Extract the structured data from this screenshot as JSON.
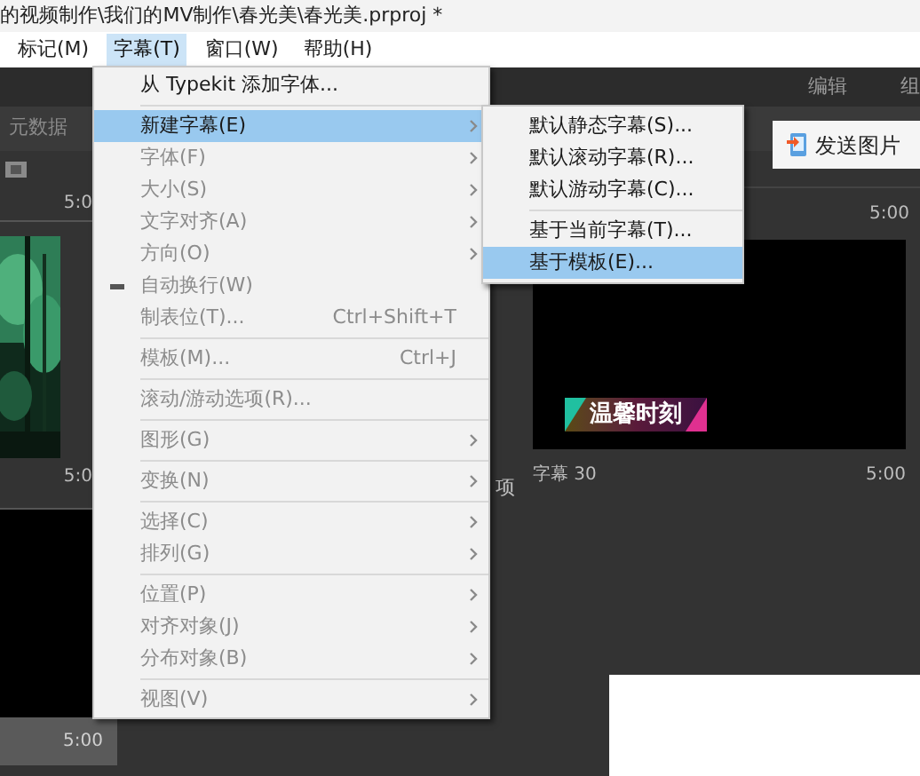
{
  "title_bar": {
    "path": "的视频制作\\我们的MV制作\\春光美\\春光美.prproj *"
  },
  "menu_bar": [
    {
      "label": "标记(M)",
      "selected": false
    },
    {
      "label": "字幕(T)",
      "selected": true
    },
    {
      "label": "窗口(W)",
      "selected": false
    },
    {
      "label": "帮助(H)",
      "selected": false
    }
  ],
  "workspace_tabs": [
    "编辑",
    "组"
  ],
  "panel_tab": "元数据",
  "left_clips": [
    {
      "kind": "forest",
      "top_time": "5:0",
      "time": "5:0"
    },
    {
      "kind": "black",
      "time": "5:00"
    }
  ],
  "cut_label": "项",
  "title_clip": {
    "top_time": "5:00",
    "caption": "温馨时刻",
    "name": "字幕 30",
    "time": "5:00"
  },
  "title_menu": {
    "items": [
      {
        "kind": "item",
        "label": "从 Typekit 添加字体...",
        "disabled": false,
        "selected": false,
        "checked": false,
        "submenu": false
      },
      {
        "kind": "separator"
      },
      {
        "kind": "item",
        "label": "新建字幕(E)",
        "disabled": false,
        "selected": true,
        "checked": false,
        "submenu": true
      },
      {
        "kind": "item",
        "label": "字体(F)",
        "disabled": true,
        "selected": false,
        "checked": false,
        "submenu": true
      },
      {
        "kind": "item",
        "label": "大小(S)",
        "disabled": true,
        "selected": false,
        "checked": false,
        "submenu": true
      },
      {
        "kind": "item",
        "label": "文字对齐(A)",
        "disabled": true,
        "selected": false,
        "checked": false,
        "submenu": true
      },
      {
        "kind": "item",
        "label": "方向(O)",
        "disabled": true,
        "selected": false,
        "checked": false,
        "submenu": true
      },
      {
        "kind": "item",
        "label": "自动换行(W)",
        "disabled": true,
        "selected": false,
        "checked": true,
        "submenu": false
      },
      {
        "kind": "item",
        "label": "制表位(T)...",
        "shortcut": "Ctrl+Shift+T",
        "disabled": true,
        "selected": false,
        "checked": false,
        "submenu": false
      },
      {
        "kind": "separator"
      },
      {
        "kind": "item",
        "label": "模板(M)...",
        "shortcut": "Ctrl+J",
        "disabled": true,
        "selected": false,
        "checked": false,
        "submenu": false
      },
      {
        "kind": "separator"
      },
      {
        "kind": "item",
        "label": "滚动/游动选项(R)...",
        "disabled": true,
        "selected": false,
        "checked": false,
        "submenu": false
      },
      {
        "kind": "separator"
      },
      {
        "kind": "item",
        "label": "图形(G)",
        "disabled": true,
        "selected": false,
        "checked": false,
        "submenu": true
      },
      {
        "kind": "separator"
      },
      {
        "kind": "item",
        "label": "变换(N)",
        "disabled": true,
        "selected": false,
        "checked": false,
        "submenu": true
      },
      {
        "kind": "separator"
      },
      {
        "kind": "item",
        "label": "选择(C)",
        "disabled": true,
        "selected": false,
        "checked": false,
        "submenu": true
      },
      {
        "kind": "item",
        "label": "排列(G)",
        "disabled": true,
        "selected": false,
        "checked": false,
        "submenu": true
      },
      {
        "kind": "separator"
      },
      {
        "kind": "item",
        "label": "位置(P)",
        "disabled": true,
        "selected": false,
        "checked": false,
        "submenu": true
      },
      {
        "kind": "item",
        "label": "对齐对象(J)",
        "disabled": true,
        "selected": false,
        "checked": false,
        "submenu": true
      },
      {
        "kind": "item",
        "label": "分布对象(B)",
        "disabled": true,
        "selected": false,
        "checked": false,
        "submenu": true
      },
      {
        "kind": "separator"
      },
      {
        "kind": "item",
        "label": "视图(V)",
        "disabled": true,
        "selected": false,
        "checked": false,
        "submenu": true
      }
    ]
  },
  "submenu": {
    "items": [
      {
        "kind": "item",
        "label": "默认静态字幕(S)...",
        "selected": false
      },
      {
        "kind": "item",
        "label": "默认滚动字幕(R)...",
        "selected": false
      },
      {
        "kind": "item",
        "label": "默认游动字幕(C)...",
        "selected": false
      },
      {
        "kind": "separator"
      },
      {
        "kind": "item",
        "label": "基于当前字幕(T)...",
        "selected": false
      },
      {
        "kind": "item",
        "label": "基于模板(E)...",
        "selected": true
      }
    ]
  },
  "send_popup": {
    "label": "发送图片"
  }
}
